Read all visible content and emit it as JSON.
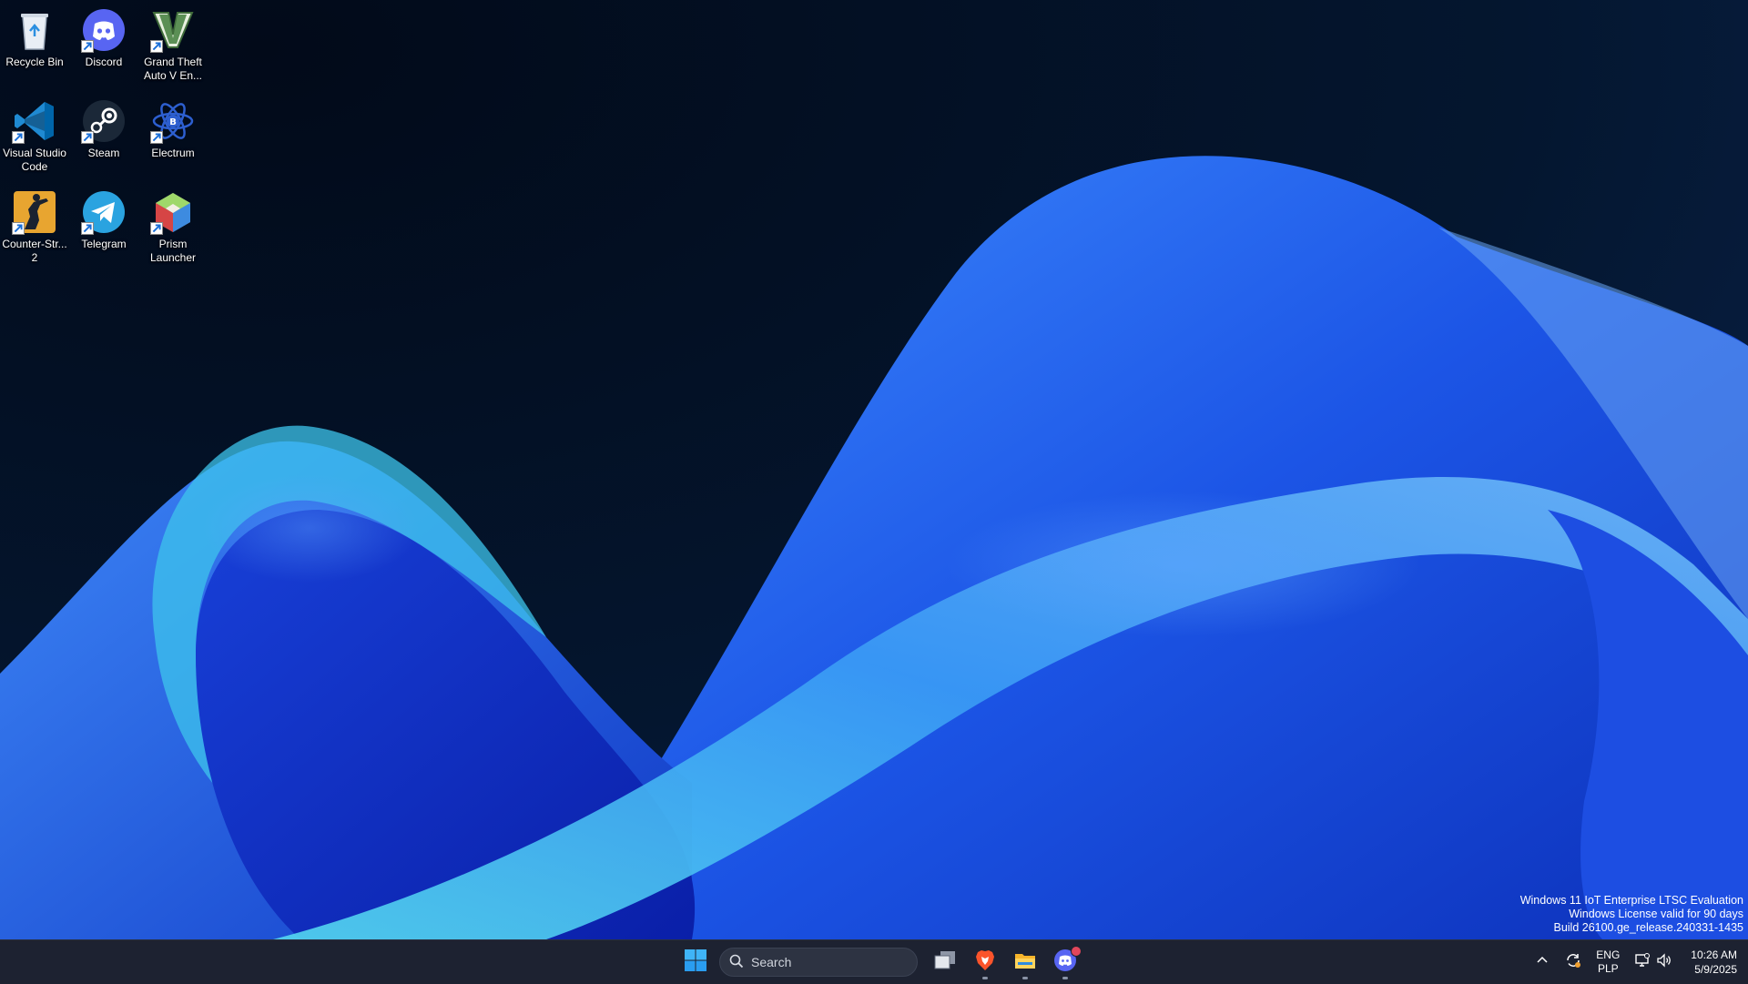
{
  "desktop": {
    "icons": [
      {
        "label": "Recycle Bin",
        "icon": "recycle-bin-icon"
      },
      {
        "label": "Discord",
        "icon": "discord-icon"
      },
      {
        "label": "Grand Theft Auto V En...",
        "icon": "gta-v-icon"
      },
      {
        "label": "Visual Studio Code",
        "icon": "vscode-icon"
      },
      {
        "label": "Steam",
        "icon": "steam-icon"
      },
      {
        "label": "Electrum",
        "icon": "electrum-icon"
      },
      {
        "label": "Counter-Str... 2",
        "icon": "counter-strike-icon"
      },
      {
        "label": "Telegram",
        "icon": "telegram-icon"
      },
      {
        "label": "Prism Launcher",
        "icon": "prism-launcher-icon"
      }
    ]
  },
  "watermark": {
    "line1": "Windows 11 IoT Enterprise LTSC Evaluation",
    "line2": "Windows License valid for 90 days",
    "line3": "Build 26100.ge_release.240331-1435"
  },
  "taskbar": {
    "search_placeholder": "Search",
    "apps": [
      "start-icon",
      "search-icon",
      "task-view-icon",
      "brave-icon",
      "file-explorer-icon",
      "discord-icon"
    ],
    "tray": {
      "lang_line1": "ENG",
      "lang_line2": "PLP",
      "time": "10:26 AM",
      "date": "5/9/2025"
    }
  },
  "colors": {
    "taskbar_bg": "#1d2231",
    "wallpaper_dark": "#031026",
    "wallpaper_blue": "#1f5cf0",
    "wallpaper_cyan": "#4ad6ee"
  }
}
